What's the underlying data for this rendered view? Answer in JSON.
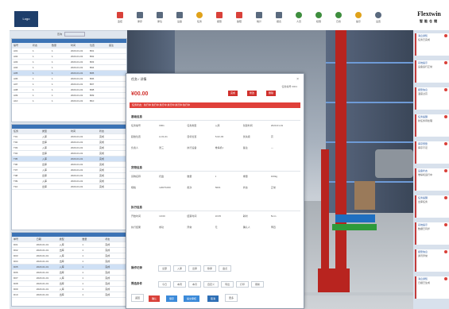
{
  "topbar": {
    "logo_left": "Logo",
    "logo_right_main": "Flextwin",
    "logo_right_sub": "智能仓储",
    "tools": [
      {
        "icon": "monitor-icon",
        "label": "监控",
        "color": "#d9413a"
      },
      {
        "icon": "grid-icon",
        "label": "库存",
        "color": "#5a6a7e"
      },
      {
        "icon": "grid-icon",
        "label": "库位",
        "color": "#5a6a7e"
      },
      {
        "icon": "grid-icon",
        "label": "设备",
        "color": "#5a6a7e"
      },
      {
        "icon": "star-icon",
        "label": "任务",
        "color": "#e0a21a"
      },
      {
        "icon": "alert-icon",
        "label": "报警",
        "color": "#d9413a"
      },
      {
        "icon": "alert-icon",
        "label": "故障",
        "color": "#d9413a"
      },
      {
        "icon": "grid-icon",
        "label": "统计",
        "color": "#5a6a7e"
      },
      {
        "icon": "grid-icon",
        "label": "报表",
        "color": "#5a6a7e"
      },
      {
        "icon": "person-icon",
        "label": "人员",
        "color": "#3e8e3e"
      },
      {
        "icon": "person-icon",
        "label": "权限",
        "color": "#3e8e3e"
      },
      {
        "icon": "person-icon",
        "label": "日志",
        "color": "#3e8e3e"
      },
      {
        "icon": "bulb-icon",
        "label": "提示",
        "color": "#e0a21a"
      },
      {
        "icon": "person-icon",
        "label": "设置",
        "color": "#5a6a7e"
      }
    ]
  },
  "left": {
    "search_label": "查询",
    "panel1": {
      "headers": [
        "编号",
        "状态",
        "数量",
        "时间",
        "位置",
        "备注"
      ],
      "rows": [
        [
          "A01",
          "1",
          "1",
          "2023-01-01",
          "B01",
          ""
        ],
        [
          "A02",
          "1",
          "1",
          "2023-01-01",
          "B02",
          ""
        ],
        [
          "A03",
          "1",
          "1",
          "2023-01-01",
          "B03",
          ""
        ],
        [
          "A04",
          "1",
          "1",
          "2023-01-01",
          "B04",
          ""
        ],
        [
          "A05",
          "1",
          "1",
          "2023-01-01",
          "B05",
          ""
        ],
        [
          "A06",
          "1",
          "1",
          "2023-01-01",
          "B06",
          ""
        ],
        [
          "A07",
          "1",
          "1",
          "2023-01-01",
          "B07",
          ""
        ],
        [
          "A08",
          "1",
          "1",
          "2023-01-01",
          "B08",
          ""
        ],
        [
          "A09",
          "1",
          "1",
          "2023-01-01",
          "B09",
          ""
        ],
        [
          "A10",
          "1",
          "1",
          "2023-01-01",
          "B10",
          ""
        ]
      ]
    },
    "panel2": {
      "headers": [
        "任务",
        "类型",
        "时间",
        "状态"
      ],
      "rows": [
        [
          "T01",
          "入库",
          "2023-01-01",
          "完成"
        ],
        [
          "T02",
          "出库",
          "2023-01-01",
          "完成"
        ],
        [
          "T03",
          "入库",
          "2023-01-01",
          "完成"
        ],
        [
          "T04",
          "出库",
          "2023-01-01",
          "完成"
        ],
        [
          "T05",
          "入库",
          "2023-01-01",
          "完成"
        ],
        [
          "T06",
          "出库",
          "2023-01-01",
          "完成"
        ],
        [
          "T07",
          "入库",
          "2023-01-01",
          "完成"
        ],
        [
          "T08",
          "出库",
          "2023-01-01",
          "完成"
        ],
        [
          "T09",
          "入库",
          "2023-01-01",
          "完成"
        ],
        [
          "T10",
          "出库",
          "2023-01-01",
          "完成"
        ]
      ]
    },
    "panel3": {
      "headers": [
        "单号",
        "日期",
        "类型",
        "数量",
        "状态"
      ],
      "rows": [
        [
          "D01",
          "2023-01-01",
          "入库",
          "1",
          "完成"
        ],
        [
          "D02",
          "2023-01-01",
          "出库",
          "1",
          "完成"
        ],
        [
          "D03",
          "2023-01-01",
          "入库",
          "1",
          "完成"
        ],
        [
          "D04",
          "2023-01-01",
          "出库",
          "1",
          "完成"
        ],
        [
          "D05",
          "2023-01-01",
          "入库",
          "1",
          "完成"
        ],
        [
          "D06",
          "2023-01-01",
          "出库",
          "1",
          "完成"
        ],
        [
          "D07",
          "2023-01-01",
          "入库",
          "1",
          "完成"
        ],
        [
          "D08",
          "2023-01-01",
          "出库",
          "1",
          "完成"
        ],
        [
          "D09",
          "2023-01-01",
          "入库",
          "1",
          "完成"
        ],
        [
          "D10",
          "2023-01-01",
          "出库",
          "1",
          "完成"
        ]
      ]
    }
  },
  "dialog": {
    "title": "任务 / 详情",
    "close": "×",
    "subtitle": "任务编号 0001",
    "amount": "¥00.00",
    "buttons": [
      "完成",
      "修改",
      "删除"
    ],
    "band": "任务状态：执行中 执行中 执行中 执行中 执行中 执行中",
    "sections": [
      {
        "title": "基础信息",
        "rows": [
          [
            "任务编号",
            "0001",
            "任务类型",
            "入库",
            "创建时间",
            "2023-01-01"
          ],
          [
            "起始位置",
            "A-01-01",
            "目标位置",
            "B-02-03",
            "优先级",
            "高"
          ],
          [
            "负责人",
            "张三",
            "执行设备",
            "堆垛机1",
            "备注",
            "—"
          ]
        ]
      },
      {
        "title": "货物信息",
        "rows": [
          [
            "货物名称",
            "托盘",
            "数量",
            "1",
            "重量",
            "100kg"
          ],
          [
            "规格",
            "1200*1000",
            "批次",
            "B001",
            "状态",
            "正常"
          ]
        ]
      },
      {
        "title": "执行信息",
        "rows": [
          [
            "开始时间",
            "10:00",
            "结束时间",
            "10:05",
            "耗时",
            "5min"
          ],
          [
            "执行结果",
            "成功",
            "异常",
            "无",
            "确认人",
            "李四"
          ]
        ]
      }
    ],
    "chips_a_label": "操作记录",
    "chips_a": [
      "全部",
      "入库",
      "出库",
      "移库",
      "盘点"
    ],
    "chips_b_label": "筛选条件",
    "chips_b": [
      "今日",
      "本周",
      "本月",
      "自定义",
      "导出",
      "打印",
      "刷新"
    ],
    "footer": [
      {
        "label": "返回",
        "color": "#ffffff",
        "text": "#555"
      },
      {
        "label": "确认",
        "color": "#d9413a",
        "text": "#fff"
      },
      {
        "label": "保存",
        "color": "#3b8ad9",
        "text": "#fff"
      },
      {
        "label": "提交审核",
        "color": "#3b8ad9",
        "text": "#fff"
      },
      {
        "label": "取消",
        "color": "#2e6fb5",
        "text": "#fff"
      },
      {
        "label": "更多",
        "color": "#ffffff",
        "text": "#555"
      }
    ]
  },
  "right": {
    "cards": [
      {
        "title": "消息通知",
        "text": "任务已完成"
      },
      {
        "title": "系统提示",
        "text": "设备运行正常"
      },
      {
        "title": "报警信息",
        "text": "温度过高"
      },
      {
        "title": "任务提醒",
        "text": "新任务待处理"
      },
      {
        "title": "库存预警",
        "text": "库存不足"
      },
      {
        "title": "设备状态",
        "text": "堆垛机运行中"
      },
      {
        "title": "任务提醒",
        "text": "出库任务"
      },
      {
        "title": "系统提示",
        "text": "数据已同步"
      },
      {
        "title": "报警信息",
        "text": "通讯异常"
      },
      {
        "title": "消息通知",
        "text": "日报已生成"
      }
    ]
  }
}
